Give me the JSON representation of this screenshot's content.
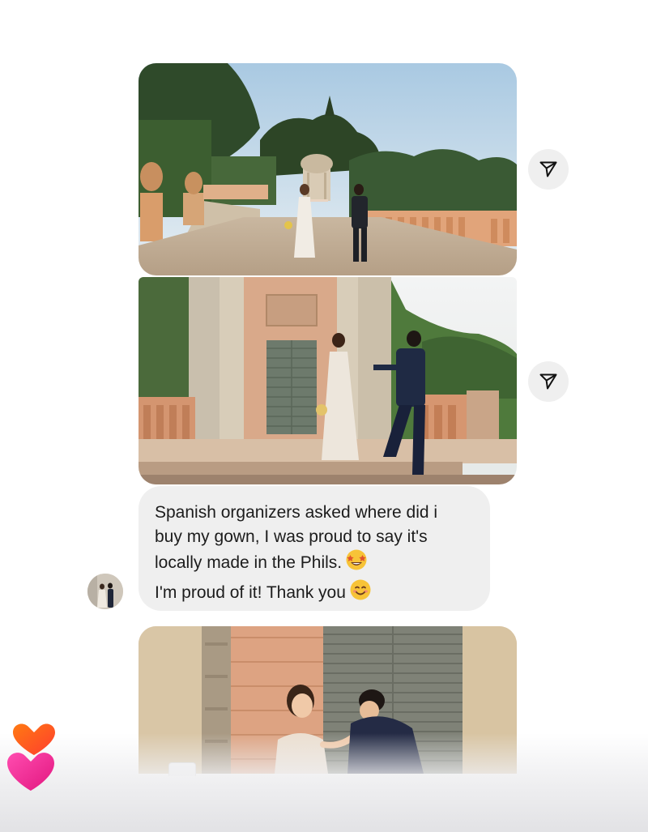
{
  "thread": {
    "messages": [
      {
        "kind": "photo",
        "id": "photo1",
        "alt": "Couple walking on garden terrace"
      },
      {
        "kind": "photo",
        "id": "photo2",
        "alt": "Couple holding hands by columns"
      },
      {
        "kind": "text",
        "lines": [
          "Spanish organizers asked where did i",
          "buy my gown, I was proud to say it's",
          "locally made in the Phils.",
          "I'm proud of it! Thank you"
        ],
        "emojis": [
          "star-struck-emoji",
          "smiling-face-emoji"
        ]
      },
      {
        "kind": "photo",
        "id": "photo3",
        "alt": "Groom kissing bride's hand"
      }
    ]
  },
  "icons": {
    "share": "paper-plane-icon",
    "reaction": "hearts-reaction-icon"
  },
  "colors": {
    "bubble_bg": "#efefef",
    "share_bg": "#efefef",
    "text": "#1c1c1c",
    "heart_orange": "#ff5a1f",
    "heart_pink": "#f0249a"
  }
}
